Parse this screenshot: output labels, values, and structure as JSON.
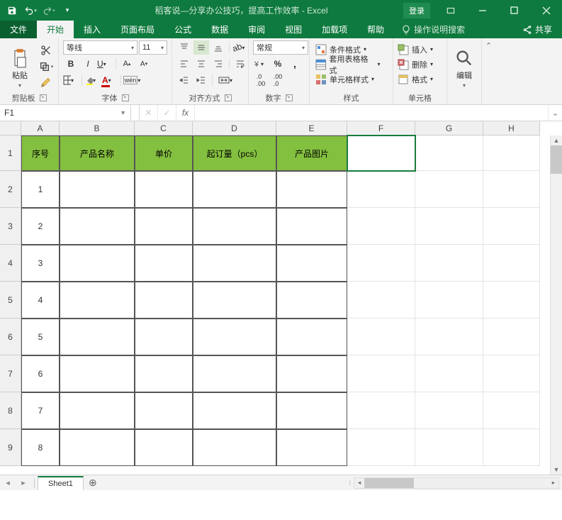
{
  "titlebar": {
    "title": "稻客说—分享办公技巧，提高工作效率 - Excel",
    "login": "登录"
  },
  "tabs": {
    "file": "文件",
    "home": "开始",
    "insert": "插入",
    "layout": "页面布局",
    "formulas": "公式",
    "data": "数据",
    "review": "审阅",
    "view": "视图",
    "addins": "加载项",
    "help": "帮助",
    "tell": "操作说明搜索",
    "share": "共享"
  },
  "ribbon": {
    "clipboard": {
      "label": "剪贴板",
      "paste": "粘贴"
    },
    "font": {
      "label": "字体",
      "name": "等线",
      "size": "11"
    },
    "align": {
      "label": "对齐方式"
    },
    "number": {
      "label": "数字",
      "format": "常规"
    },
    "styles": {
      "label": "样式",
      "cond": "条件格式",
      "table": "套用表格格式",
      "cell": "单元格样式"
    },
    "cells": {
      "label": "单元格",
      "insert": "插入",
      "delete": "删除",
      "format": "格式"
    },
    "editing": {
      "label": "编辑"
    }
  },
  "namebox": "F1",
  "columns": [
    {
      "id": "A",
      "w": 54
    },
    {
      "id": "B",
      "w": 106
    },
    {
      "id": "C",
      "w": 82
    },
    {
      "id": "D",
      "w": 118
    },
    {
      "id": "E",
      "w": 100
    },
    {
      "id": "F",
      "w": 96
    },
    {
      "id": "G",
      "w": 96
    },
    {
      "id": "H",
      "w": 80
    }
  ],
  "rows": [
    {
      "id": "1",
      "h": 50
    },
    {
      "id": "2",
      "h": 52
    },
    {
      "id": "3",
      "h": 52
    },
    {
      "id": "4",
      "h": 52
    },
    {
      "id": "5",
      "h": 52
    },
    {
      "id": "6",
      "h": 52
    },
    {
      "id": "7",
      "h": 52
    },
    {
      "id": "8",
      "h": 52
    },
    {
      "id": "9",
      "h": 52
    }
  ],
  "headers": [
    "序号",
    "产品名称",
    "单价",
    "起订量（pcs）",
    "产品图片"
  ],
  "dataRows": [
    "1",
    "2",
    "3",
    "4",
    "5",
    "6",
    "7",
    "8"
  ],
  "sheet": "Sheet1",
  "selected": {
    "col": "F",
    "row": "1"
  }
}
